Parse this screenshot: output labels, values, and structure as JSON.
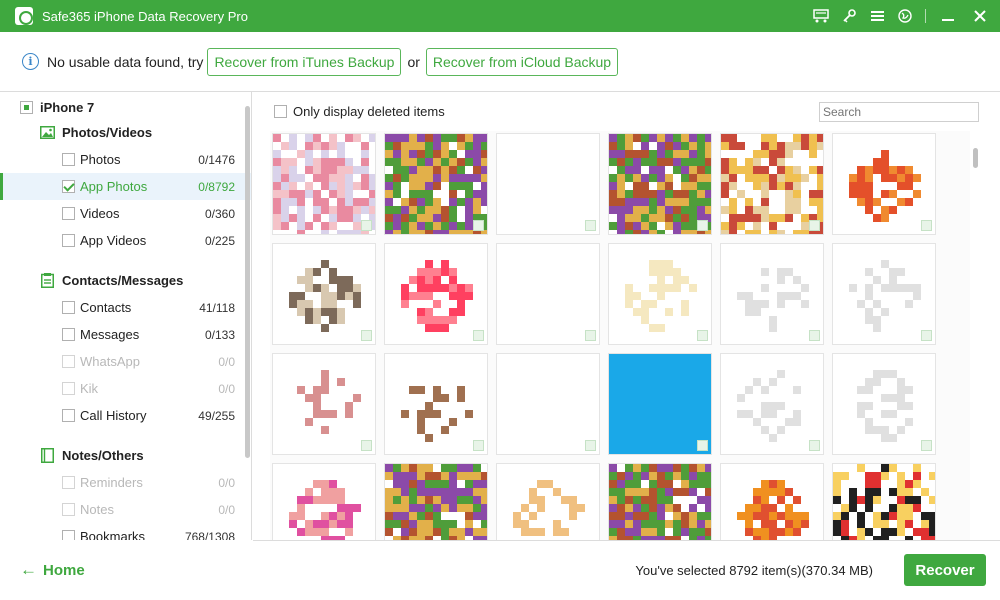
{
  "titlebar": {
    "title": "Safe365 iPhone Data Recovery Pro",
    "icons": [
      "cart-icon",
      "key-icon",
      "menu-icon",
      "globe-icon"
    ],
    "window_controls": [
      "minimize-icon",
      "close-icon"
    ]
  },
  "infobar": {
    "message": "No usable data found, try",
    "itunes_label": "Recover from iTunes Backup",
    "or_text": "or",
    "icloud_label": "Recover from iCloud Backup"
  },
  "sidebar": {
    "device": "iPhone 7",
    "groups": [
      {
        "title": "Photos/Videos",
        "icon": "image-icon",
        "items": [
          {
            "label": "Photos",
            "count": "0/1476"
          },
          {
            "label": "App Photos",
            "count": "0/8792"
          },
          {
            "label": "Videos",
            "count": "0/360"
          },
          {
            "label": "App Videos",
            "count": "0/225"
          }
        ]
      },
      {
        "title": "Contacts/Messages",
        "icon": "contacts-icon",
        "items": [
          {
            "label": "Contacts",
            "count": "41/118"
          },
          {
            "label": "Messages",
            "count": "0/133"
          },
          {
            "label": "WhatsApp",
            "count": "0/0"
          },
          {
            "label": "Kik",
            "count": "0/0"
          },
          {
            "label": "Call History",
            "count": "49/255"
          }
        ]
      },
      {
        "title": "Notes/Others",
        "icon": "notebook-icon",
        "items": [
          {
            "label": "Reminders",
            "count": "0/0"
          },
          {
            "label": "Notes",
            "count": "0/0"
          },
          {
            "label": "Bookmarks",
            "count": "768/1308"
          }
        ]
      }
    ],
    "home_label": "Home"
  },
  "main": {
    "filter_label": "Only display deleted items",
    "search_placeholder": "Search",
    "selection_text": "You've selected 8792 item(s)(370.34 MB)",
    "recover_label": "Recover"
  },
  "colors": {
    "brand_green": "#3fa83f",
    "selected_row_bg": "#eaf3fb",
    "info_blue": "#3a86c8"
  }
}
